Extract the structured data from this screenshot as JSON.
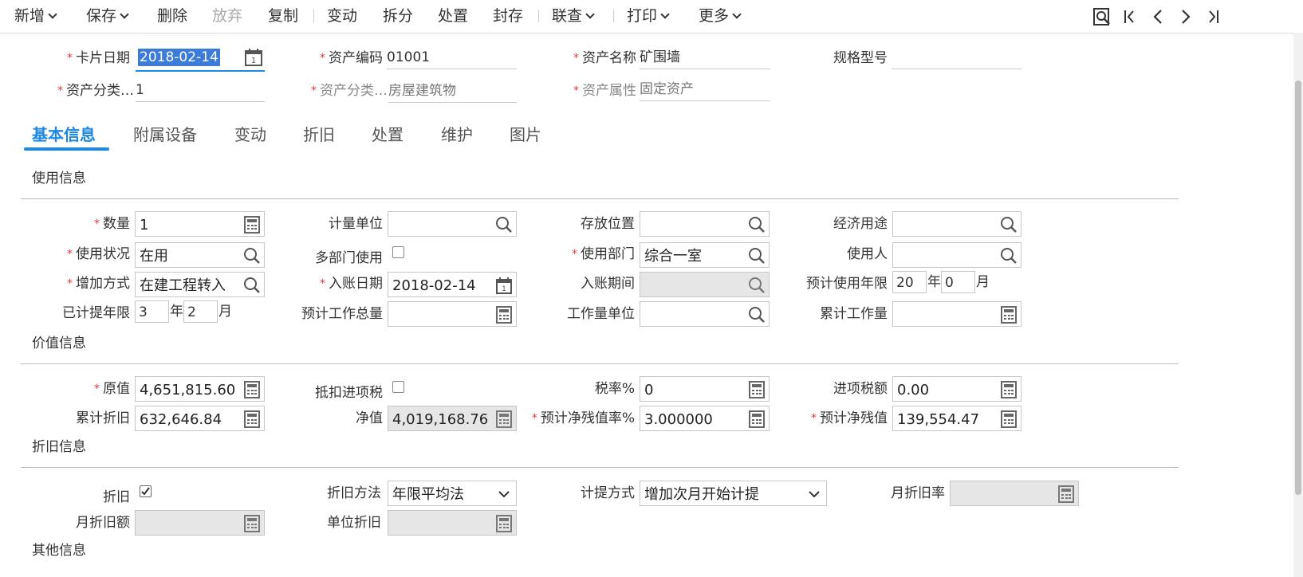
{
  "toolbar": {
    "add": "新增",
    "save": "保存",
    "delete": "删除",
    "discard": "放弃",
    "copy": "复制",
    "change": "变动",
    "split": "拆分",
    "dispose": "处置",
    "archive": "封存",
    "linked": "联查",
    "print": "打印",
    "more": "更多"
  },
  "header": {
    "card_date_label": "卡片日期",
    "card_date_value": "2018-02-14",
    "asset_code_label": "资产编码",
    "asset_code_value": "01001",
    "asset_name_label": "资产名称",
    "asset_name_value": "矿围墙",
    "spec_label": "规格型号",
    "spec_value": "",
    "category_code_label": "资产分类…",
    "category_code_value": "1",
    "category_name_label": "资产分类…",
    "category_name_value": "房屋建筑物",
    "attribute_label": "资产属性",
    "attribute_value": "固定资产"
  },
  "tabs": [
    "基本信息",
    "附属设备",
    "变动",
    "折旧",
    "处置",
    "维护",
    "图片"
  ],
  "usage": {
    "title": "使用信息",
    "quantity_label": "数量",
    "quantity_value": "1",
    "measure_unit_label": "计量单位",
    "measure_unit_value": "",
    "location_label": "存放位置",
    "location_value": "",
    "economic_use_label": "经济用途",
    "economic_use_value": "",
    "status_label": "使用状况",
    "status_value": "在用",
    "multi_dept_label": "多部门使用",
    "dept_label": "使用部门",
    "dept_value": "综合一室",
    "user_label": "使用人",
    "user_value": "",
    "add_method_label": "增加方式",
    "add_method_value": "在建工程转入",
    "entry_date_label": "入账日期",
    "entry_date_value": "2018-02-14",
    "entry_period_label": "入账期间",
    "entry_period_value": "",
    "life_label": "预计使用年限",
    "life_years": "20",
    "life_months": "0",
    "depr_years_label": "已计提年限",
    "depr_years": "3",
    "depr_months": "2",
    "total_work_label": "预计工作总量",
    "total_work_value": "",
    "work_unit_label": "工作量单位",
    "work_unit_value": "",
    "cum_work_label": "累计工作量",
    "cum_work_value": "",
    "year_unit": "年",
    "month_unit": "月"
  },
  "value": {
    "title": "价值信息",
    "original_label": "原值",
    "original_value": "4,651,815.60",
    "deduct_tax_label": "抵扣进项税",
    "tax_rate_label": "税率%",
    "tax_rate_value": "0",
    "input_tax_label": "进项税额",
    "input_tax_value": "0.00",
    "cum_depr_label": "累计折旧",
    "cum_depr_value": "632,646.84",
    "net_label": "净值",
    "net_value": "4,019,168.76",
    "residual_rate_label": "预计净残值率%",
    "residual_rate_value": "3.000000",
    "residual_label": "预计净残值",
    "residual_value": "139,554.47"
  },
  "depreciation": {
    "title": "折旧信息",
    "depr_label": "折旧",
    "depr_checked": true,
    "method_label": "折旧方法",
    "method_value": "年限平均法",
    "accrual_label": "计提方式",
    "accrual_value": "增加次月开始计提",
    "monthly_rate_label": "月折旧率",
    "monthly_rate_value": "",
    "monthly_amount_label": "月折旧额",
    "monthly_amount_value": "",
    "unit_depr_label": "单位折旧",
    "unit_depr_value": ""
  },
  "other": {
    "title": "其他信息"
  }
}
